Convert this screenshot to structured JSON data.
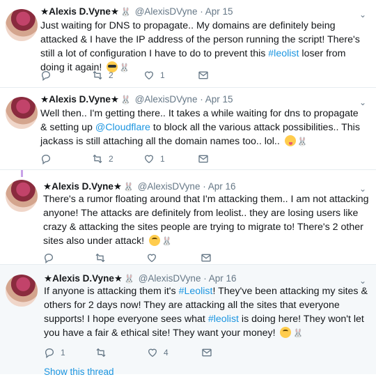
{
  "tweets": [
    {
      "name": "★Alexis D.Vyne★",
      "handle": "@AlexisDVyne",
      "dot": "·",
      "date": "Apr 15",
      "text_parts": [
        "Just waiting for DNS to propagate.. My domains are definitely being attacked & I have the IP address of the person running the script! There's still a lot of configuration I have to do to prevent this ",
        "#leolist",
        " loser from doing it again!"
      ],
      "replies": "",
      "retweets": "2",
      "likes": "1"
    },
    {
      "name": "★Alexis D.Vyne★",
      "handle": "@AlexisDVyne",
      "dot": "·",
      "date": "Apr 15",
      "text_parts": [
        "Well then.. I'm getting there.. It takes a while waiting for dns to propagate & setting up ",
        "@Cloudflare",
        " to block all the various attack possibilities.. This jackass is still attaching all the domain names too.. lol.."
      ],
      "replies": "",
      "retweets": "2",
      "likes": "1"
    },
    {
      "name": "★Alexis D.Vyne★",
      "handle": "@AlexisDVyne",
      "dot": "·",
      "date": "Apr 16",
      "text_parts": [
        "There's a rumor floating around that I'm attacking them.. I am not attacking anyone! The attacks are definitely from leolist.. they are losing users like crazy & attacking the sites people are trying to migrate to! There's 2 other sites also under attack!"
      ],
      "replies": "",
      "retweets": "",
      "likes": ""
    },
    {
      "name": "★Alexis D.Vyne★",
      "handle": "@AlexisDVyne",
      "dot": "·",
      "date": "Apr 16",
      "text_parts": [
        "If anyone is attacking them it's ",
        "#Leolist",
        "! They've been attacking my sites & others for 2 days now! They are attacking all the sites that everyone supports! I hope everyone sees what ",
        "#leolist",
        " is doing here! They won't let you have a fair & ethical site! They want your money!"
      ],
      "replies": "1",
      "retweets": "",
      "likes": "4",
      "show_thread": "Show this thread"
    }
  ],
  "icons": {
    "reply": "reply-icon",
    "retweet": "retweet-icon",
    "like": "heart-icon",
    "dm": "envelope-icon",
    "caret": "chevron-down-icon"
  },
  "colors": {
    "link": "#1b95e0",
    "muted": "#657786",
    "highlight_bg": "#f5f8fa"
  }
}
